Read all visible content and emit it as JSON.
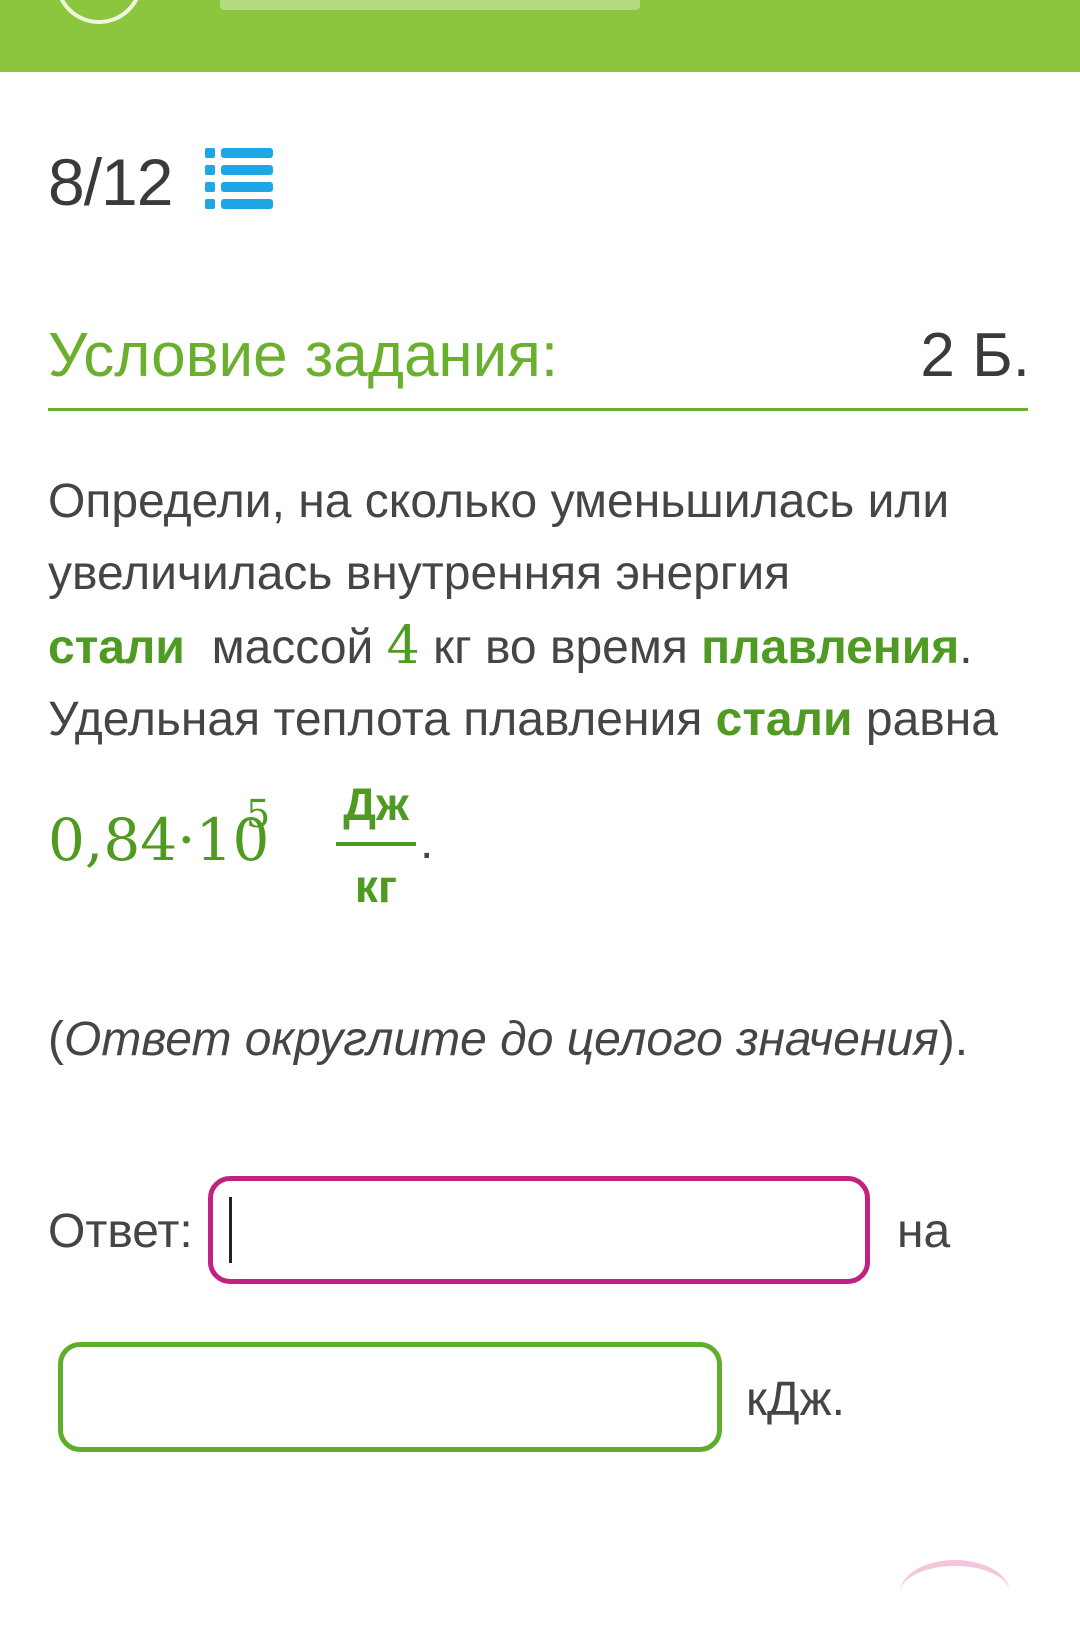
{
  "header": {
    "counter": "8/12",
    "list_icon": "list-icon"
  },
  "task": {
    "section_title": "Условие задания:",
    "points": "2 Б.",
    "line1": "Определи, на сколько уменьшилась или",
    "line2": "увеличилась внутренняя энергия",
    "word_steel": "стали",
    "word_mass": "массой",
    "mass_value": "4",
    "mass_unit_time": "кг во время",
    "word_melting": "плавления",
    "period": ".",
    "line4_start": "Удельная теплота плавления",
    "word_steel_2": "стали",
    "line4_end": "равна",
    "formula_base": "0,84·10",
    "formula_exp": "5",
    "formula_num": "Дж",
    "formula_den": "кг",
    "formula_dot": ".",
    "note_open": "(",
    "note_text": "Ответ округлите до целого значения",
    "note_close": ")."
  },
  "answer": {
    "label": "Ответ:",
    "input1_value": "",
    "suffix1": "на",
    "input2_value": "",
    "suffix2": "кДж."
  },
  "colors": {
    "top_bar": "#8cc63f",
    "accent_green": "#6aaf2e",
    "highlight_green": "#4e9a22",
    "active_input_border": "#c2227f",
    "inactive_input_border": "#5fae2b",
    "list_icon": "#1ea6e6"
  }
}
